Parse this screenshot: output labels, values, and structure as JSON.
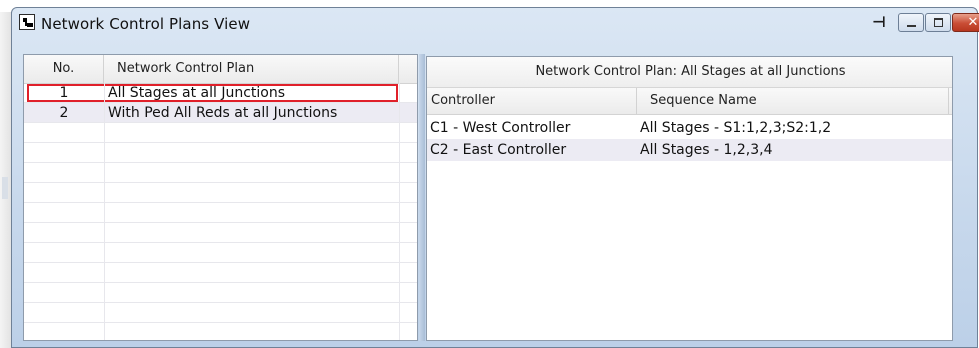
{
  "window": {
    "title": "Network Control Plans View",
    "close_glyph": "✕",
    "pin_glyph": "⊣"
  },
  "plans_table": {
    "columns": [
      "No.",
      "Network Control Plan"
    ],
    "rows": [
      {
        "no": "1",
        "plan": "All Stages at all Junctions"
      },
      {
        "no": "2",
        "plan": "With Ped All Reds at all Junctions"
      }
    ],
    "selected_index": 0,
    "selection_color": "#e0202a"
  },
  "detail": {
    "caption": "Network Control Plan: All Stages at all Junctions",
    "columns": [
      "Controller",
      "Sequence Name"
    ],
    "rows": [
      {
        "controller": "C1 - West Controller",
        "sequence": "All Stages - S1:1,2,3;S2:1,2"
      },
      {
        "controller": "C2 - East Controller",
        "sequence": "All Stages - 1,2,3,4"
      }
    ]
  }
}
